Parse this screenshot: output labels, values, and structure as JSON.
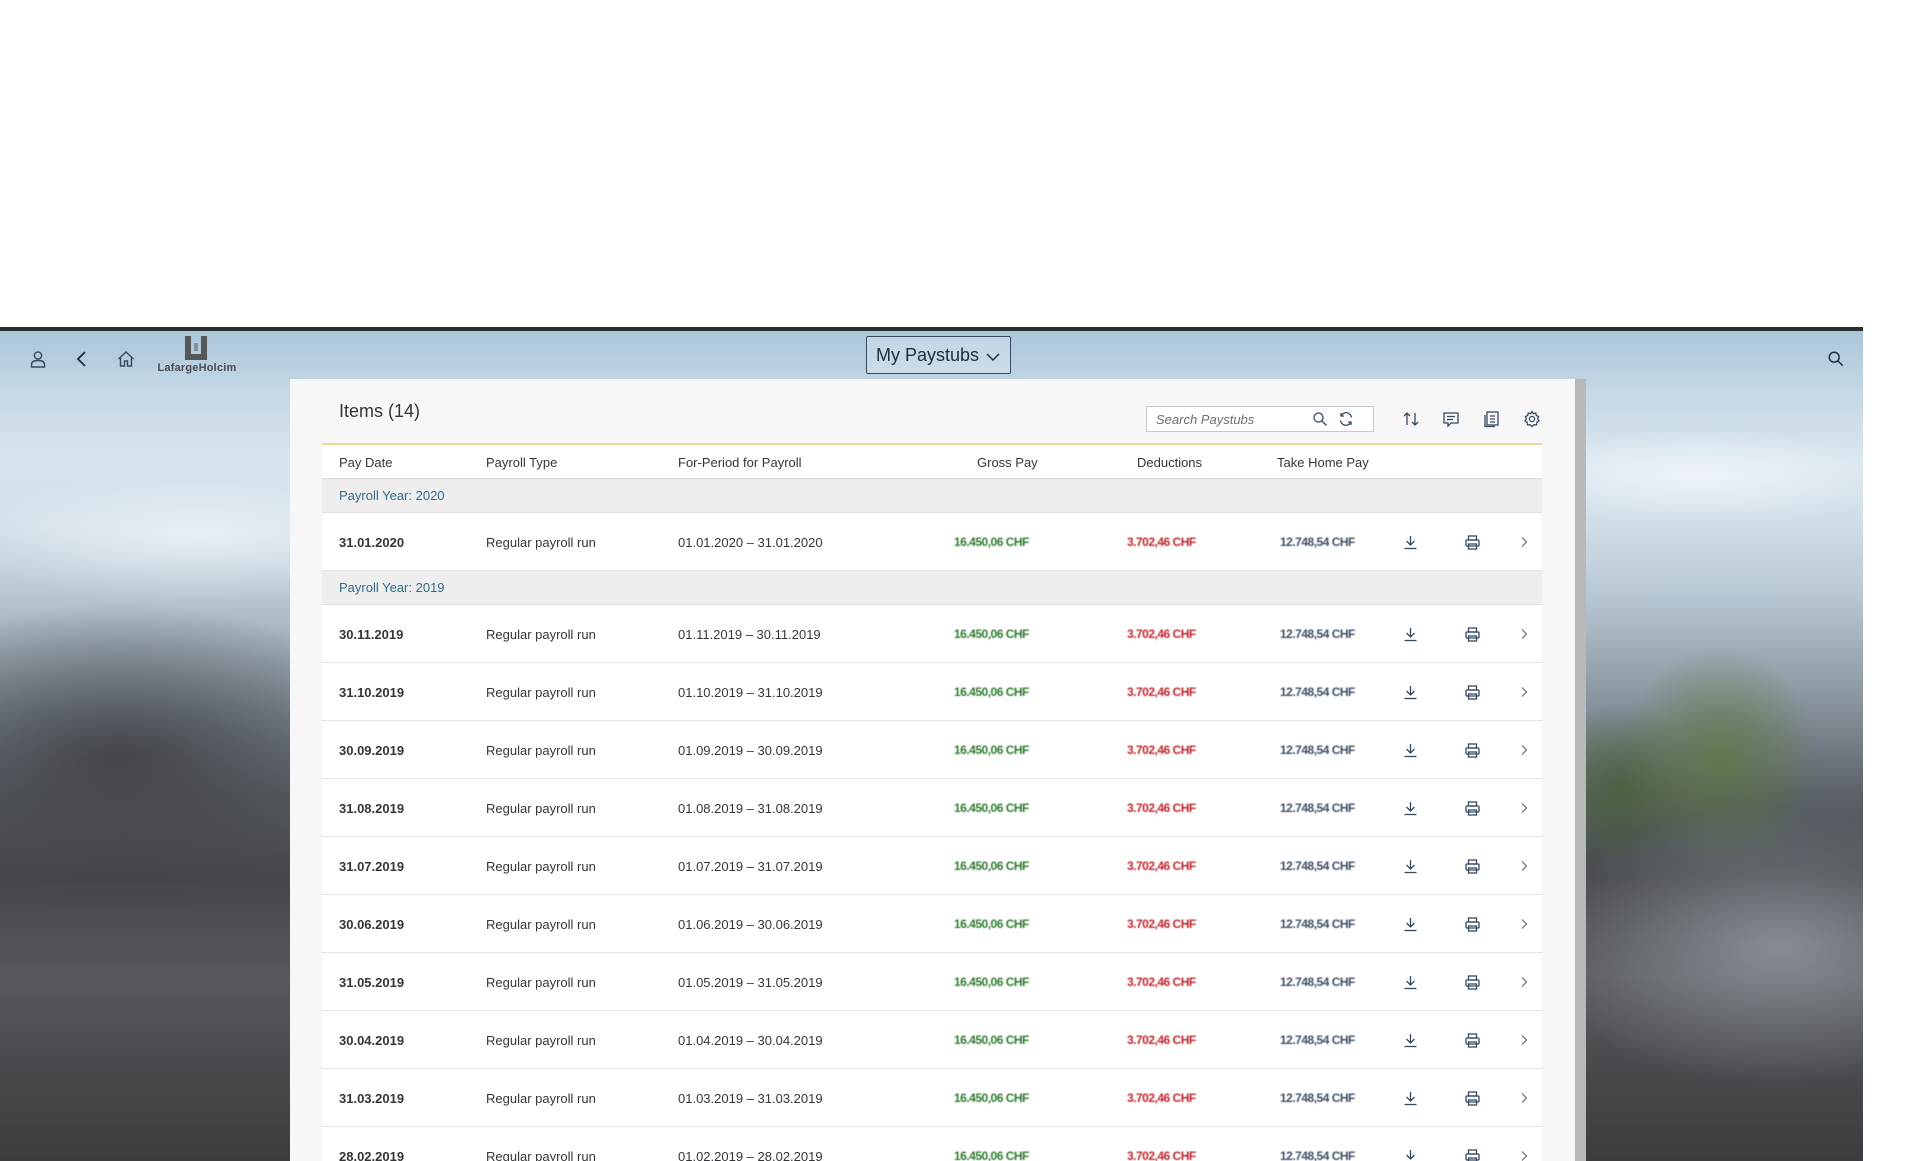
{
  "shell": {
    "title": "My Paystubs",
    "logo_text": "LafargeHolcim"
  },
  "toolbar": {
    "items_label": "Items (14)",
    "search_placeholder": "Search Paystubs"
  },
  "columns": [
    "Pay Date",
    "Payroll Type",
    "For-Period for Payroll",
    "Gross Pay",
    "Deductions",
    "Take Home Pay"
  ],
  "groups": [
    {
      "label": "Payroll Year: 2020",
      "rows": [
        {
          "date": "31.01.2020",
          "type": "Regular payroll run",
          "period": "01.01.2020 – 31.01.2020",
          "gross": "16.450,06 CHF",
          "deductions": "3.702,46 CHF",
          "take_home": "12.748,54 CHF"
        }
      ]
    },
    {
      "label": "Payroll Year: 2019",
      "rows": [
        {
          "date": "30.11.2019",
          "type": "Regular payroll run",
          "period": "01.11.2019 – 30.11.2019",
          "gross": "16.450,06 CHF",
          "deductions": "3.702,46 CHF",
          "take_home": "12.748,54 CHF"
        },
        {
          "date": "31.10.2019",
          "type": "Regular payroll run",
          "period": "01.10.2019 – 31.10.2019",
          "gross": "16.450,06 CHF",
          "deductions": "3.702,46 CHF",
          "take_home": "12.748,54 CHF"
        },
        {
          "date": "30.09.2019",
          "type": "Regular payroll run",
          "period": "01.09.2019 – 30.09.2019",
          "gross": "16.450,06 CHF",
          "deductions": "3.702,46 CHF",
          "take_home": "12.748,54 CHF"
        },
        {
          "date": "31.08.2019",
          "type": "Regular payroll run",
          "period": "01.08.2019 – 31.08.2019",
          "gross": "16.450,06 CHF",
          "deductions": "3.702,46 CHF",
          "take_home": "12.748,54 CHF"
        },
        {
          "date": "31.07.2019",
          "type": "Regular payroll run",
          "period": "01.07.2019 – 31.07.2019",
          "gross": "16.450,06 CHF",
          "deductions": "3.702,46 CHF",
          "take_home": "12.748,54 CHF"
        },
        {
          "date": "30.06.2019",
          "type": "Regular payroll run",
          "period": "01.06.2019 – 30.06.2019",
          "gross": "16.450,06 CHF",
          "deductions": "3.702,46 CHF",
          "take_home": "12.748,54 CHF"
        },
        {
          "date": "31.05.2019",
          "type": "Regular payroll run",
          "period": "01.05.2019 – 31.05.2019",
          "gross": "16.450,06 CHF",
          "deductions": "3.702,46 CHF",
          "take_home": "12.748,54 CHF"
        },
        {
          "date": "30.04.2019",
          "type": "Regular payroll run",
          "period": "01.04.2019 – 30.04.2019",
          "gross": "16.450,06 CHF",
          "deductions": "3.702,46 CHF",
          "take_home": "12.748,54 CHF"
        },
        {
          "date": "31.03.2019",
          "type": "Regular payroll run",
          "period": "01.03.2019 – 31.03.2019",
          "gross": "16.450,06 CHF",
          "deductions": "3.702,46 CHF",
          "take_home": "12.748,54 CHF"
        },
        {
          "date": "28.02.2019",
          "type": "Regular payroll run",
          "period": "01.02.2019 – 28.02.2019",
          "gross": "16.450,06 CHF",
          "deductions": "3.702,46 CHF",
          "take_home": "12.748,54 CHF"
        }
      ]
    }
  ],
  "icons": {
    "user": "user-icon",
    "back": "back-arrow-icon",
    "home": "home-icon",
    "shell_search": "search-icon",
    "search": "search-icon",
    "refresh": "refresh-icon",
    "sort": "sort-icon",
    "filter": "filter-icon",
    "export": "export-icon",
    "settings": "gear-icon",
    "download": "download-icon",
    "print": "print-icon",
    "navigate": "chevron-right-icon"
  },
  "colors": {
    "accent_line": "#e6d892",
    "group_text": "#2f6c8a",
    "gross": "#2f7b2f",
    "deductions": "#c0262d",
    "icon_blue": "#354a5f"
  }
}
